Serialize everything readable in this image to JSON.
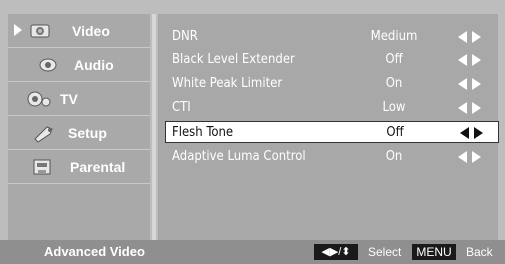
{
  "sidebar": {
    "items": [
      {
        "label": "Video",
        "icon": "video-icon",
        "selected": true
      },
      {
        "label": "Audio",
        "icon": "audio-icon",
        "selected": false
      },
      {
        "label": "TV",
        "icon": "tv-icon",
        "selected": false
      },
      {
        "label": "Setup",
        "icon": "setup-icon",
        "selected": false
      },
      {
        "label": "Parental",
        "icon": "parental-icon",
        "selected": false
      }
    ]
  },
  "settings": {
    "rows": [
      {
        "name": "DNR",
        "value": "Medium"
      },
      {
        "name": "Black Level Extender",
        "value": "Off"
      },
      {
        "name": "White Peak Limiter",
        "value": "On"
      },
      {
        "name": "CTI",
        "value": "Low"
      },
      {
        "name": "Flesh Tone",
        "value": "Off",
        "selected": true
      },
      {
        "name": "Adaptive Luma Control",
        "value": "On"
      }
    ]
  },
  "footer": {
    "title": "Advanced Video",
    "nav_key": "◀▶/⬍",
    "select_label": "Select",
    "menu_key": "MENU",
    "back_label": "Back"
  },
  "colors": {
    "panel": "#a8a8a8",
    "footer": "#8f8f8f",
    "selected_row": "#ffffff"
  }
}
